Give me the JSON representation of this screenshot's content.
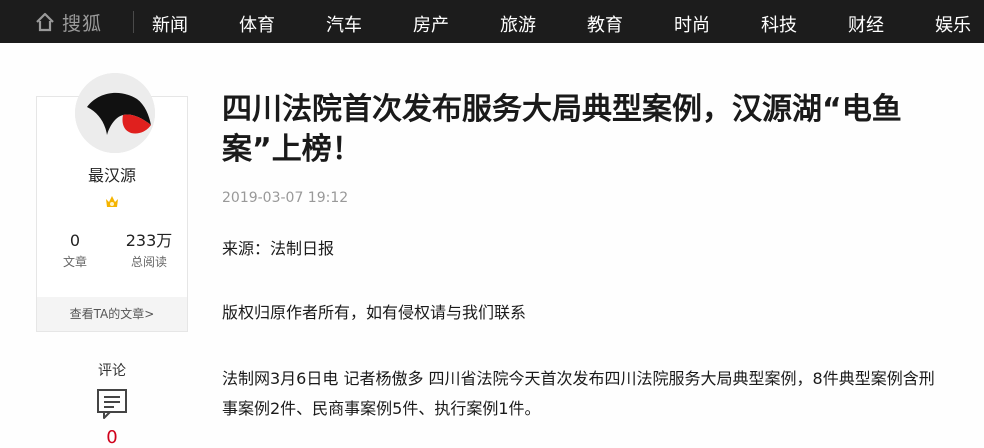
{
  "header": {
    "logo_text": "搜狐",
    "nav": [
      "新闻",
      "体育",
      "汽车",
      "房产",
      "旅游",
      "教育",
      "时尚",
      "科技",
      "财经",
      "娱乐"
    ]
  },
  "author": {
    "name": "最汉源",
    "articles_count": "0",
    "articles_label": "文章",
    "reads_count": "233万",
    "reads_label": "总阅读",
    "view_articles_link": "查看TA的文章>"
  },
  "comments": {
    "label": "评论",
    "count": "0"
  },
  "article": {
    "title": "四川法院首次发布服务大局典型案例，汉源湖“电鱼案”上榜！",
    "date": "2019-03-07 19:12",
    "source": "来源：法制日报",
    "copyright": "版权归原作者所有，如有侵权请与我们联系",
    "lead": "法制网3月6日电 记者杨傲多 四川省法院今天首次发布四川法院服务大局典型案例，8件典型案例含刑事案例2件、民商事案例5件、执行案例1件。"
  },
  "colors": {
    "topbar_bg": "#1c1c1c",
    "accent_red": "#d0021b"
  }
}
